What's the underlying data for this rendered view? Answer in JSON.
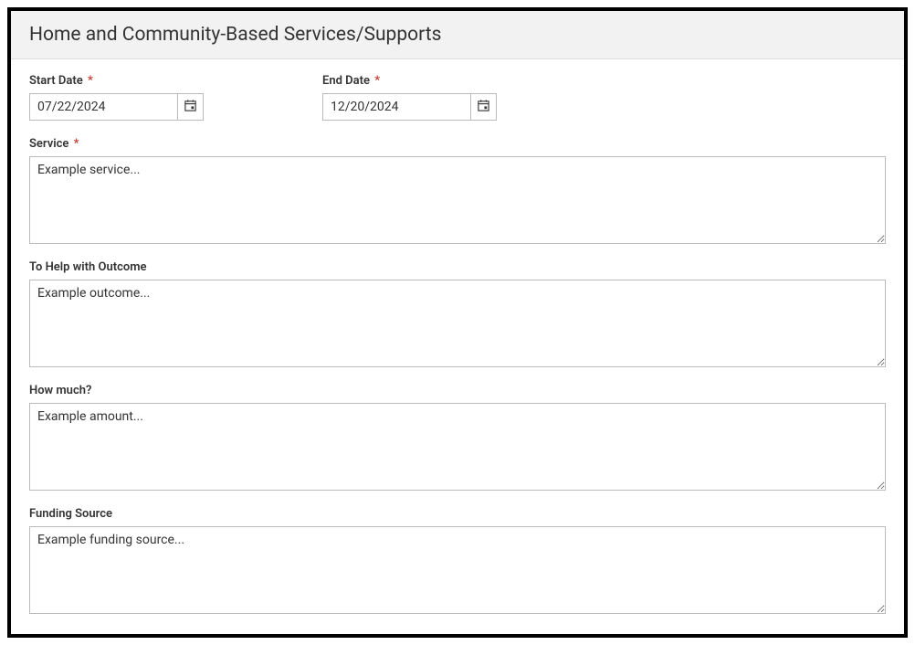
{
  "header": {
    "title": "Home and Community-Based Services/Supports"
  },
  "fields": {
    "startDate": {
      "label": "Start Date",
      "value": "07/22/2024",
      "required": true
    },
    "endDate": {
      "label": "End Date",
      "value": "12/20/2024",
      "required": true
    },
    "service": {
      "label": "Service",
      "value": "Example service...",
      "required": true
    },
    "outcome": {
      "label": "To Help with Outcome",
      "value": "Example outcome...",
      "required": false
    },
    "howMuch": {
      "label": "How much?",
      "value": "Example amount...",
      "required": false
    },
    "fundingSource": {
      "label": "Funding Source",
      "value": "Example funding source...",
      "required": false
    }
  },
  "requiredMark": "*"
}
